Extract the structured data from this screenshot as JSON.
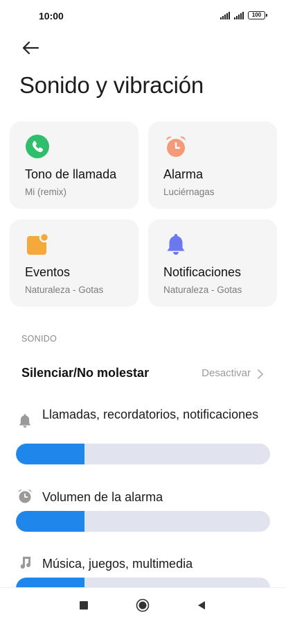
{
  "status_bar": {
    "time": "10:00",
    "battery": "100",
    "icons": [
      "signal-icon",
      "signal-icon",
      "battery-icon"
    ]
  },
  "header": {
    "back_icon": "arrow-left-icon",
    "title": "Sonido y vibración"
  },
  "cards": [
    {
      "title": "Tono de llamada",
      "subtitle": "Mi (remix)",
      "icon": "phone-icon",
      "color": "#2fbe6b"
    },
    {
      "title": "Alarma",
      "subtitle": "Luciérnagas",
      "icon": "alarm-clock-icon",
      "color": "#f59a78"
    },
    {
      "title": "Eventos",
      "subtitle": "Naturaleza - Gotas",
      "icon": "calendar-event-icon",
      "color": "#f5a93b"
    },
    {
      "title": "Notificaciones",
      "subtitle": "Naturaleza - Gotas",
      "icon": "bell-icon",
      "color": "#6c78ef"
    }
  ],
  "sound_section": {
    "header": "SONIDO",
    "dnd": {
      "label": "Silenciar/No molestar",
      "value": "Desactivar"
    },
    "volumes": [
      {
        "label": "Llamadas, recordatorios, notificaciones",
        "icon": "bell-icon",
        "level": 0.27
      },
      {
        "label": "Volumen de la alarma",
        "icon": "alarm-clock-icon",
        "level": 0.27
      },
      {
        "label": "Música, juegos, multimedia",
        "icon": "music-note-icon",
        "level": 0.27
      }
    ]
  },
  "accent_color": "#1f87ec",
  "nav_bar": {
    "buttons": [
      "recents-square-icon",
      "home-circle-icon",
      "back-triangle-icon"
    ]
  }
}
